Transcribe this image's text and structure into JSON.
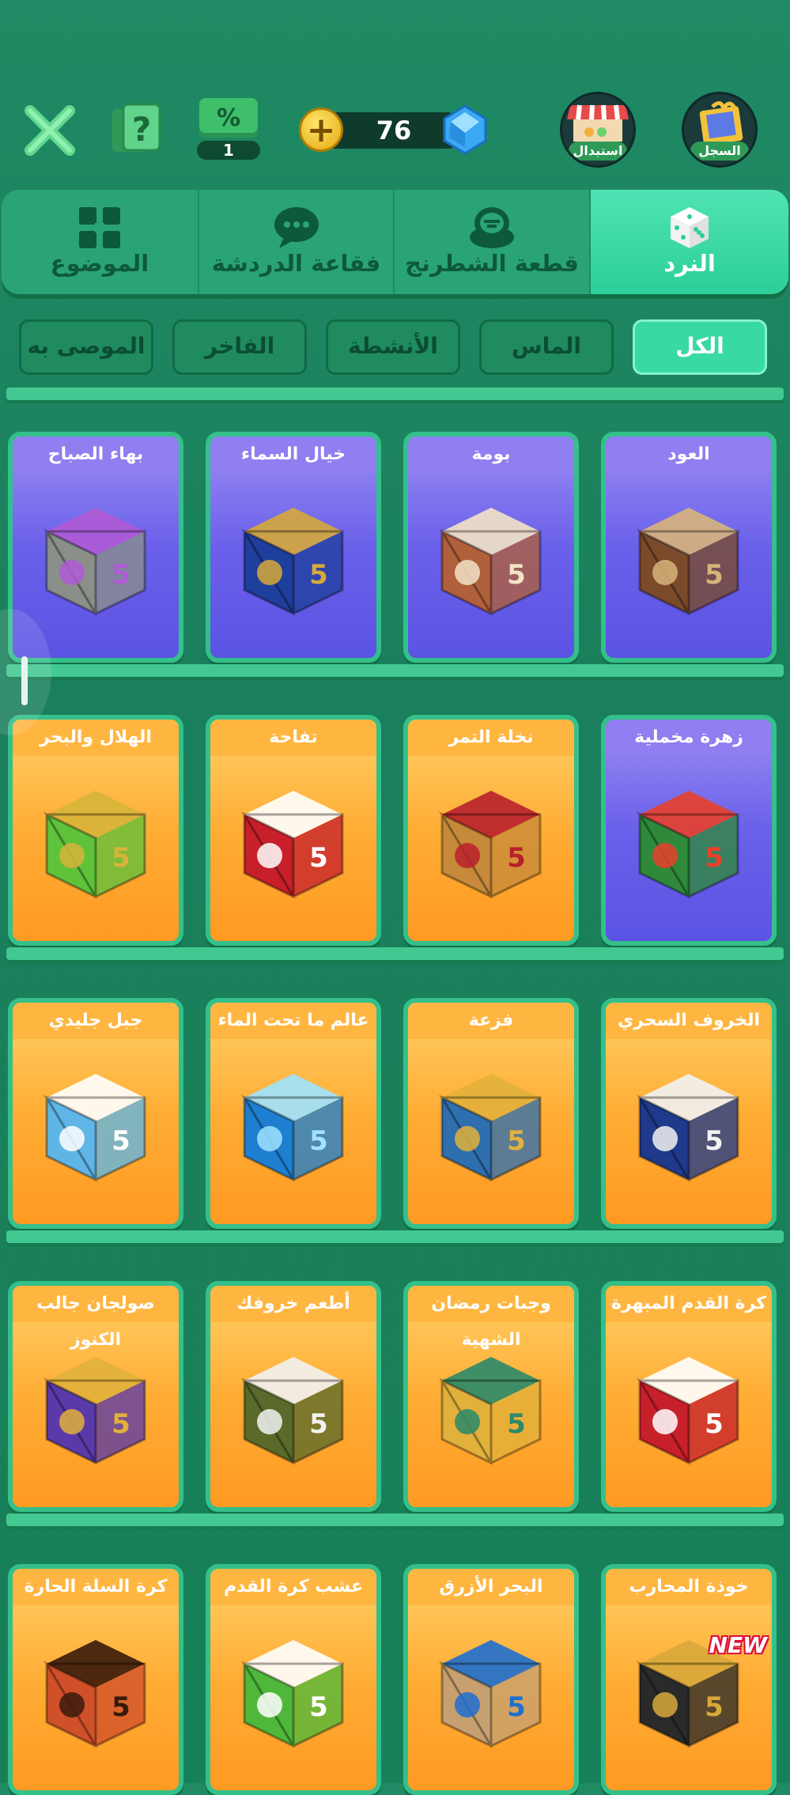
{
  "topbar": {
    "coupon_count": "1",
    "gem_count": "76",
    "shop_label": "استبدال",
    "record_label": "السجل"
  },
  "tabs": [
    {
      "label": "الموضوع",
      "icon": "grid-icon"
    },
    {
      "label": "فقاعة الدردشة",
      "icon": "chat-bubble-icon"
    },
    {
      "label": "قطعة الشطرنج",
      "icon": "chess-piece-icon"
    },
    {
      "label": "النرد",
      "icon": "dice-icon",
      "active": true
    }
  ],
  "filters": [
    {
      "label": "الموصى به"
    },
    {
      "label": "الفاخر"
    },
    {
      "label": "الأنشطة"
    },
    {
      "label": "الماس"
    },
    {
      "label": "الكل",
      "active": true
    }
  ],
  "rows": [
    [
      {
        "title": "بهاء الصباح",
        "theme": "purple",
        "color": "#8a8f8a",
        "accent": "#b05bd6"
      },
      {
        "title": "خيال السماء",
        "theme": "purple",
        "color": "#1f3f9c",
        "accent": "#d7a93b"
      },
      {
        "title": "بومة",
        "theme": "purple",
        "color": "#b0603a",
        "accent": "#f3e3c7"
      },
      {
        "title": "العود",
        "theme": "purple",
        "color": "#7a4a2a",
        "accent": "#d8b47a"
      }
    ],
    [
      {
        "title": "الهلال والبحر",
        "theme": "orange",
        "color": "#5fc23b",
        "accent": "#d7b43a"
      },
      {
        "title": "تفاحة",
        "theme": "orange",
        "color": "#c7202b",
        "accent": "#ffffff"
      },
      {
        "title": "نخلة التمر",
        "theme": "orange",
        "color": "#c78a3a",
        "accent": "#b8202b"
      },
      {
        "title": "زهرة مخملية",
        "theme": "purple",
        "color": "#2e8a3a",
        "accent": "#e8402b"
      }
    ],
    [
      {
        "title": "جبل جليدي",
        "theme": "orange",
        "color": "#5fb6e6",
        "accent": "#ffffff"
      },
      {
        "title": "عالم ما تحت الماء",
        "theme": "orange",
        "color": "#1e7fd0",
        "accent": "#9fe3ff"
      },
      {
        "title": "فزعة",
        "theme": "orange",
        "color": "#2f6fb0",
        "accent": "#e2b13b"
      },
      {
        "title": "الخروف السحري",
        "theme": "orange",
        "color": "#1f3a8a",
        "accent": "#f2f2f2"
      }
    ],
    [
      {
        "title": "صولجان جالب الكنوز",
        "theme": "orange",
        "color": "#5a3aa8",
        "accent": "#e2b13b"
      },
      {
        "title": "أطعم خروفك",
        "theme": "orange",
        "color": "#5a6a2a",
        "accent": "#f2f2f2"
      },
      {
        "title": "وجبات رمضان الشهية",
        "theme": "orange",
        "color": "#e2b13b",
        "accent": "#2a8a6a"
      },
      {
        "title": "كرة القدم المبهرة",
        "theme": "orange",
        "color": "#c7202b",
        "accent": "#ffffff"
      }
    ],
    [
      {
        "title": "كرة السلة الحارة",
        "theme": "orange",
        "color": "#d0502a",
        "accent": "#3a1a0a"
      },
      {
        "title": "عشب كرة القدم",
        "theme": "orange",
        "color": "#4fb83b",
        "accent": "#ffffff"
      },
      {
        "title": "البحر الأزرق",
        "theme": "orange",
        "color": "#c7a070",
        "accent": "#1e6fd0"
      },
      {
        "title": "خوذة المحارب",
        "theme": "orange",
        "color": "#2a2a2a",
        "accent": "#d7a93b",
        "badge": "NEW"
      }
    ]
  ]
}
